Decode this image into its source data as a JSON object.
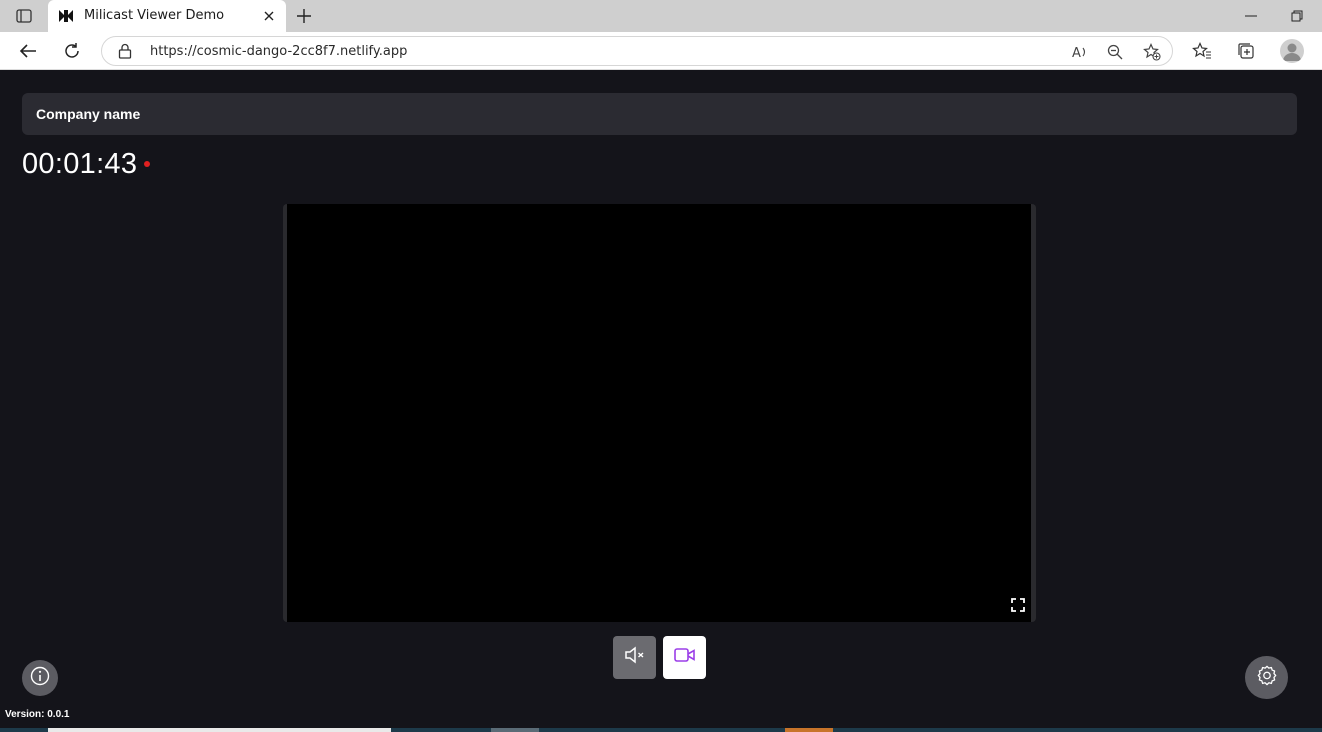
{
  "browser": {
    "tab_title": "Milicast Viewer Demo",
    "url": "https://cosmic-dango-2cc8f7.netlify.app"
  },
  "page": {
    "company_name": "Company name",
    "timer": "00:01:43",
    "version": "Version: 0.0.1"
  },
  "colors": {
    "page_bg": "#14141a",
    "header_bg": "#2b2b32",
    "live_dot": "#e02020",
    "camera_icon": "#9b3ee8"
  },
  "icons": {
    "fullscreen": "fullscreen-icon",
    "mute": "volume-muted-icon",
    "camera": "video-camera-icon",
    "info": "info-icon",
    "settings": "gear-icon"
  }
}
